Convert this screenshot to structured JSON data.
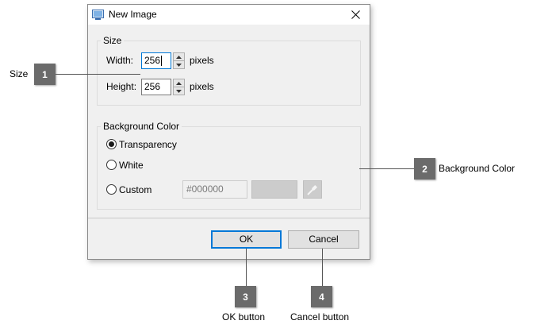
{
  "dialog": {
    "title": "New Image",
    "size_group": {
      "legend": "Size",
      "width_label": "Width:",
      "width_value": "256",
      "height_label": "Height:",
      "height_value": "256",
      "unit": "pixels"
    },
    "background_group": {
      "legend": "Background Color",
      "options": [
        {
          "label": "Transparency",
          "checked": true
        },
        {
          "label": "White",
          "checked": false
        },
        {
          "label": "Custom",
          "checked": false
        }
      ],
      "custom_hex": "#000000",
      "swatch_color": "#cccccc"
    },
    "ok_label": "OK",
    "cancel_label": "Cancel"
  },
  "callouts": [
    {
      "number": "1",
      "label": "Size"
    },
    {
      "number": "2",
      "label": "Background Color"
    },
    {
      "number": "3",
      "label": "OK button"
    },
    {
      "number": "4",
      "label": "Cancel button"
    }
  ],
  "colors": {
    "accent": "#0078d7",
    "badge": "#6b6b6b",
    "dialog_bg": "#f0f0f0"
  }
}
